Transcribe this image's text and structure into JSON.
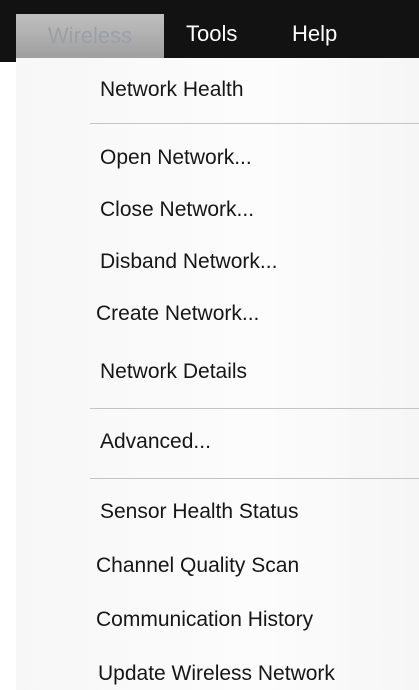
{
  "menubar": {
    "items": [
      {
        "label": "Wireless"
      },
      {
        "label": "Tools"
      },
      {
        "label": "Help"
      }
    ]
  },
  "menu": {
    "items": [
      {
        "label": "Network Health"
      },
      {
        "label": "Open Network..."
      },
      {
        "label": "Close Network..."
      },
      {
        "label": "Disband Network..."
      },
      {
        "label": "Create Network..."
      },
      {
        "label": "Network Details"
      },
      {
        "label": "Advanced..."
      },
      {
        "label": "Sensor Health Status"
      },
      {
        "label": "Channel Quality Scan"
      },
      {
        "label": "Communication History"
      },
      {
        "label": "Update Wireless Network"
      }
    ]
  }
}
